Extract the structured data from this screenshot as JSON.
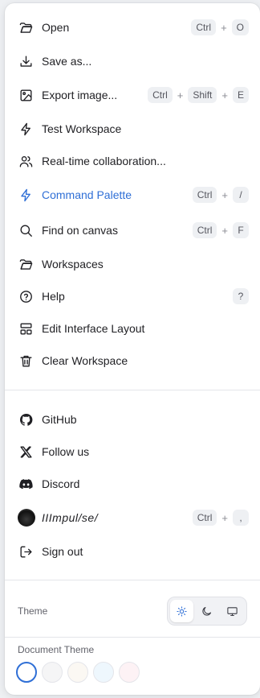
{
  "menu": {
    "items": [
      {
        "label": "Open",
        "icon": "folder-open-icon",
        "shortcut": [
          "Ctrl",
          "O"
        ]
      },
      {
        "label": "Save as...",
        "icon": "download-icon",
        "shortcut": []
      },
      {
        "label": "Export image...",
        "icon": "image-icon",
        "shortcut": [
          "Ctrl",
          "Shift",
          "E"
        ]
      },
      {
        "label": "Test Workspace",
        "icon": "lightning-icon",
        "shortcut": []
      },
      {
        "label": "Real-time collaboration...",
        "icon": "users-icon",
        "shortcut": []
      },
      {
        "label": "Command Palette",
        "icon": "lightning-icon",
        "shortcut": [
          "Ctrl",
          "/"
        ],
        "active": true
      },
      {
        "label": "Find on canvas",
        "icon": "search-icon",
        "shortcut": [
          "Ctrl",
          "F"
        ]
      },
      {
        "label": "Workspaces",
        "icon": "folder-icon",
        "shortcut": []
      },
      {
        "label": "Help",
        "icon": "help-circle-icon",
        "shortcut": [
          "?"
        ]
      },
      {
        "label": "Edit Interface Layout",
        "icon": "layout-icon",
        "shortcut": []
      },
      {
        "label": "Clear Workspace",
        "icon": "trash-icon",
        "shortcut": []
      }
    ],
    "links": [
      {
        "label": "GitHub",
        "icon": "github-icon"
      },
      {
        "label": "Follow us",
        "icon": "x-logo-icon"
      },
      {
        "label": "Discord",
        "icon": "discord-icon"
      }
    ],
    "user": {
      "name": "IIImpul/se/",
      "shortcut": [
        "Ctrl",
        ","
      ]
    },
    "sign_out": {
      "label": "Sign out",
      "icon": "sign-out-icon"
    }
  },
  "theme": {
    "label": "Theme",
    "options": [
      "light",
      "dark",
      "system"
    ],
    "selected": "light"
  },
  "document_theme": {
    "label": "Document Theme",
    "swatches": [
      "#ffffff",
      "#f5f5f6",
      "#fbf8f3",
      "#eef7fd",
      "#fdf2f5"
    ],
    "selected_index": 0
  },
  "colors": {
    "accent": "#2f6fd6"
  }
}
